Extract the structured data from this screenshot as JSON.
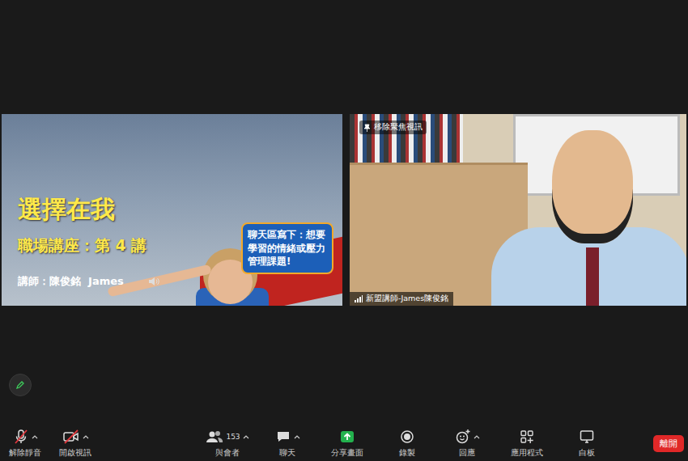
{
  "slide": {
    "title": "選擇在我",
    "subtitle": "職場講座：第 4 講",
    "speaker": "講師：陳俊銘  James",
    "callout": "聊天區寫下：想要學習的情緒或壓力管理課題!"
  },
  "video": {
    "pin_label": "移除聚焦視訊",
    "name_label": "新盟講師-James陳俊銘"
  },
  "toolbar": [
    {
      "kind": "audio",
      "label": "解除靜音",
      "menu": true,
      "off": true,
      "count": ""
    },
    {
      "kind": "video",
      "label": "開啟視訊",
      "menu": true,
      "off": true,
      "count": ""
    },
    {
      "kind": "participants",
      "label": "與會者",
      "menu": true,
      "off": false,
      "count": "153"
    },
    {
      "kind": "chat",
      "label": "聊天",
      "menu": true,
      "off": false,
      "count": ""
    },
    {
      "kind": "share",
      "label": "分享畫面",
      "menu": false,
      "off": false,
      "count": ""
    },
    {
      "kind": "record",
      "label": "錄製",
      "menu": false,
      "off": false,
      "count": ""
    },
    {
      "kind": "reactions",
      "label": "回應",
      "menu": true,
      "off": false,
      "count": ""
    },
    {
      "kind": "apps",
      "label": "應用程式",
      "menu": false,
      "off": false,
      "count": ""
    },
    {
      "kind": "whiteboard",
      "label": "白板",
      "menu": false,
      "off": false,
      "count": ""
    }
  ],
  "leave": {
    "label": "離開"
  }
}
